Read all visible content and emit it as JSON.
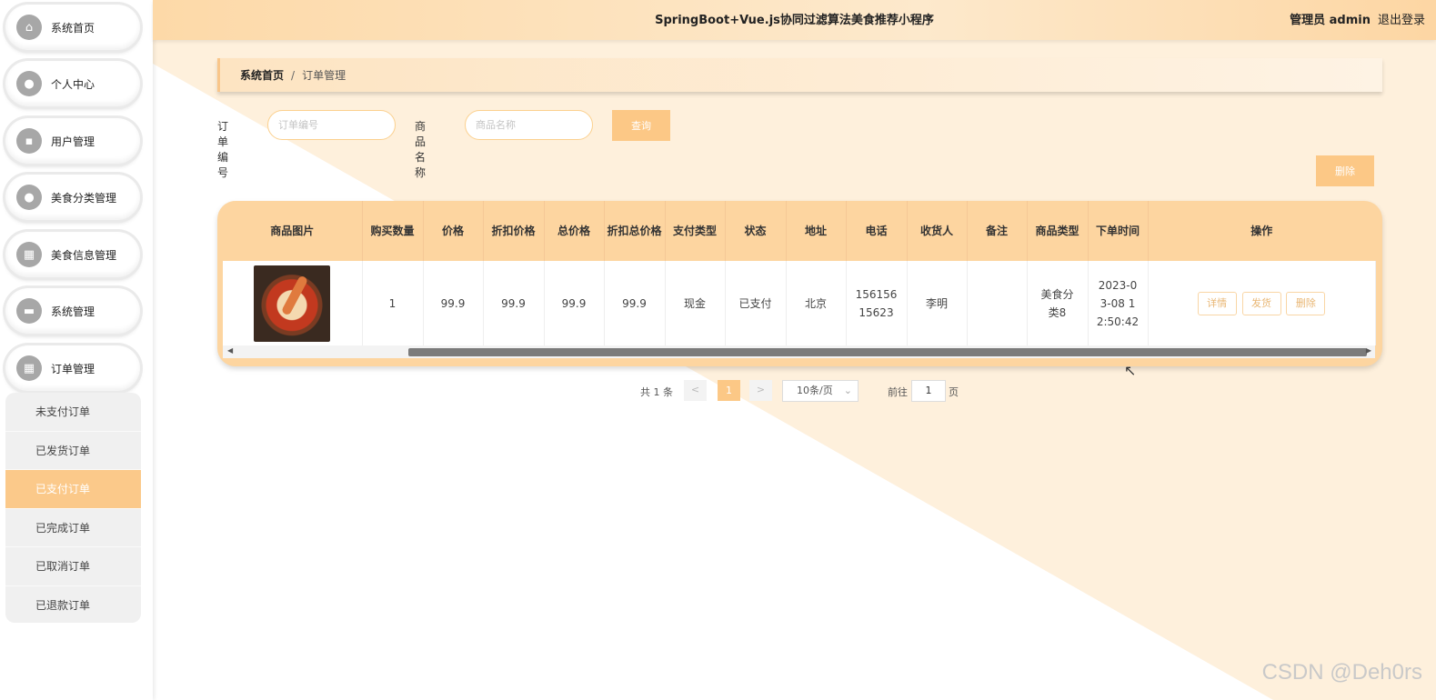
{
  "header": {
    "title": "SpringBoot+Vue.js协同过滤算法美食推荐小程序",
    "user": "管理员 admin",
    "logout": "退出登录"
  },
  "sidebar": {
    "items": [
      {
        "label": "系统首页",
        "icon": "home-icon"
      },
      {
        "label": "个人中心",
        "icon": "user-icon"
      },
      {
        "label": "用户管理",
        "icon": "chat-icon"
      },
      {
        "label": "美食分类管理",
        "icon": "user-icon"
      },
      {
        "label": "美食信息管理",
        "icon": "grid-icon"
      },
      {
        "label": "系统管理",
        "icon": "briefcase-icon"
      },
      {
        "label": "订单管理",
        "icon": "grid-icon"
      }
    ],
    "submenu": [
      "未支付订单",
      "已发货订单",
      "已支付订单",
      "已完成订单",
      "已取消订单",
      "已退款订单"
    ],
    "active_sub": "已支付订单"
  },
  "breadcrumb": {
    "home": "系统首页",
    "separator": "/",
    "current": "订单管理"
  },
  "search": {
    "order_label": "订单编号",
    "order_placeholder": "订单编号",
    "product_label": "商品名称",
    "product_placeholder": "商品名称",
    "query_button": "查询"
  },
  "toolbar": {
    "delete_button": "删除"
  },
  "table": {
    "headers": [
      "商品图片",
      "购买数量",
      "价格",
      "折扣价格",
      "总价格",
      "折扣总价格",
      "支付类型",
      "状态",
      "地址",
      "电话",
      "收货人",
      "备注",
      "商品类型",
      "下单时间",
      "操作"
    ],
    "rows": [
      {
        "image": "food-image",
        "quantity": "1",
        "price": "99.9",
        "discount_price": "99.9",
        "total": "99.9",
        "discount_total": "99.9",
        "pay_type": "现金",
        "status": "已支付",
        "address": "北京",
        "phone": "15615615623",
        "receiver": "李明",
        "note": "",
        "category": "美食分类8",
        "order_time": "2023-03-08 12:50:42",
        "actions": [
          "详情",
          "发货",
          "删除"
        ]
      }
    ]
  },
  "pagination": {
    "total": "共 1 条",
    "prev": "<",
    "page": "1",
    "next": ">",
    "page_size": "10条/页",
    "goto": "前往",
    "goto_value": "1",
    "page_unit": "页"
  },
  "watermark": "CSDN @Deh0rs",
  "colors": {
    "accent": "#fcc886",
    "header": "#fdd9a8",
    "background": "#fef0dc"
  }
}
